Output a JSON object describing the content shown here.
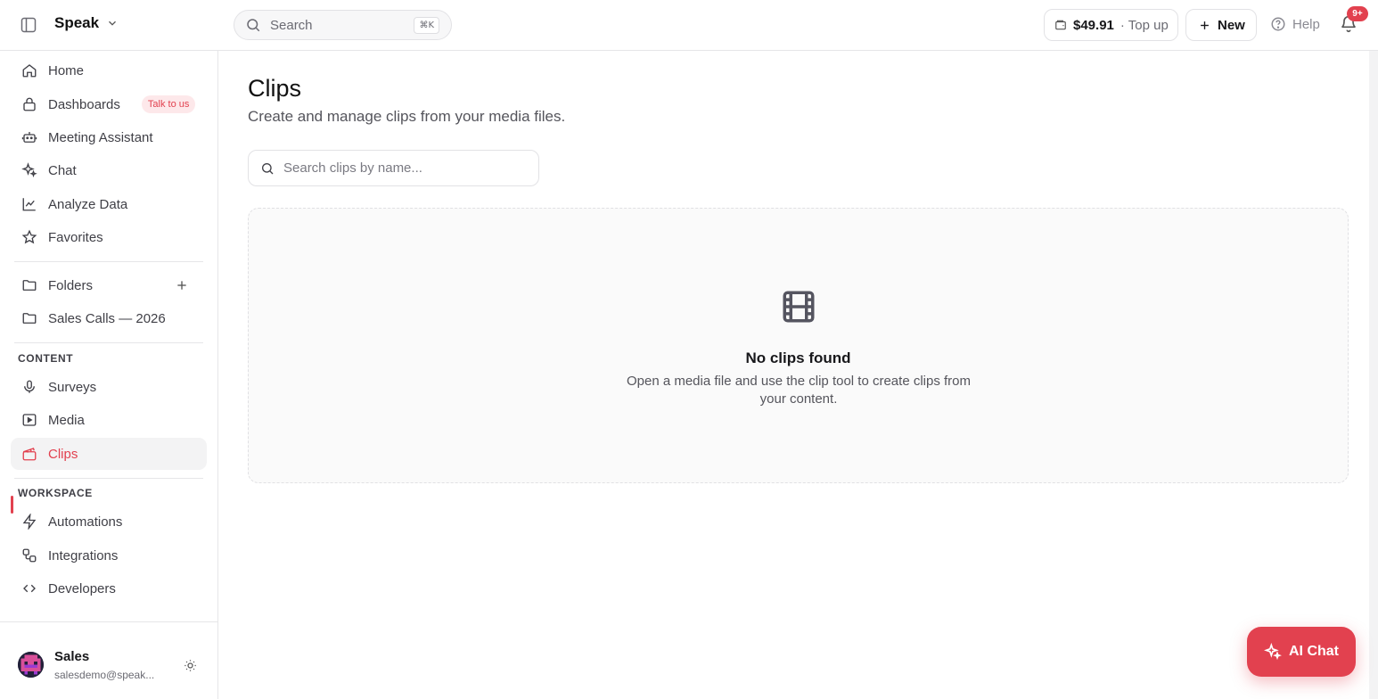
{
  "header": {
    "brand": "Speak",
    "search_label": "Search",
    "search_shortcut": "⌘K",
    "credits_amount": "$49.91",
    "credits_action": "· Top up",
    "new_label": "New",
    "help_label": "Help",
    "notifications_badge": "9+"
  },
  "sidebar": {
    "items": [
      {
        "label": "Home",
        "icon": "home-icon"
      },
      {
        "label": "Dashboards",
        "icon": "lock-icon",
        "pill": "Talk to us"
      },
      {
        "label": "Meeting Assistant",
        "icon": "bot-icon"
      },
      {
        "label": "Chat",
        "icon": "sparkles-icon"
      },
      {
        "label": "Analyze Data",
        "icon": "line-chart-icon"
      },
      {
        "label": "Favorites",
        "icon": "star-icon"
      }
    ],
    "folders_label": "Folders",
    "folder_items": [
      "Sales Calls — 2026"
    ],
    "content_section": "CONTENT",
    "content_items": [
      {
        "label": "Surveys",
        "icon": "mic-icon"
      },
      {
        "label": "Media",
        "icon": "media-icon"
      },
      {
        "label": "Clips",
        "icon": "clip-icon",
        "active": true
      }
    ],
    "workspace_section": "WORKSPACE",
    "workspace_items": [
      {
        "label": "Automations",
        "icon": "zap-icon"
      },
      {
        "label": "Integrations",
        "icon": "integrations-icon"
      },
      {
        "label": "Developers",
        "icon": "code-icon"
      }
    ],
    "user": {
      "name": "Sales",
      "email": "salesdemo@speak..."
    }
  },
  "main": {
    "title": "Clips",
    "subtitle": "Create and manage clips from your media files.",
    "search_placeholder": "Search clips by name...",
    "empty_title": "No clips found",
    "empty_text": "Open a media file and use the clip tool to create clips from your content."
  },
  "ai_chat_label": "AI Chat",
  "colors": {
    "accent": "#e2414f",
    "text": "#18181b",
    "muted": "#6b6b73",
    "border": "#e6e6e8"
  }
}
